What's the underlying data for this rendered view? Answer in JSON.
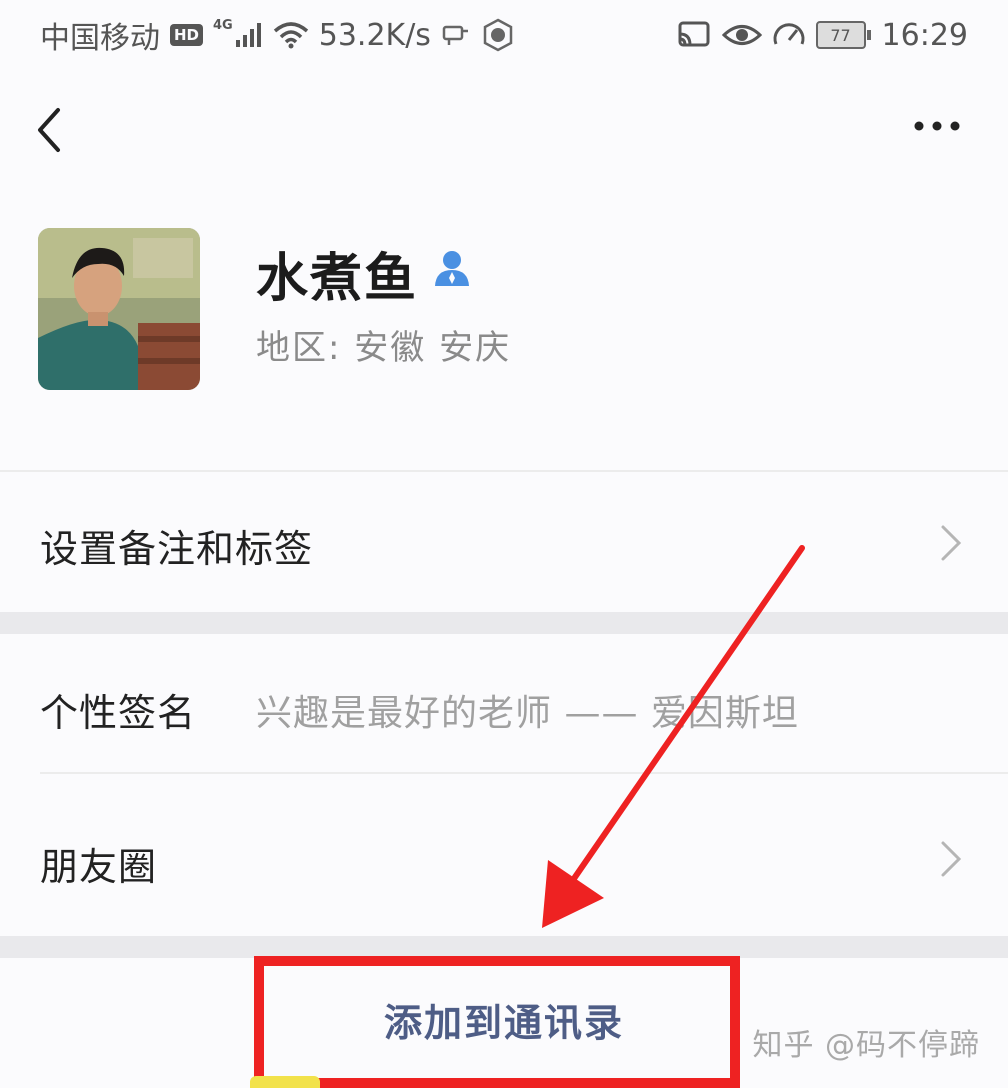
{
  "status_bar": {
    "carrier": "中国移动",
    "hd_badge": "HD",
    "network_type": "4G",
    "net_speed": "53.2K/s",
    "battery_level": "77",
    "time": "16:29"
  },
  "profile": {
    "name": "水煮鱼",
    "region": "地区: 安徽  安庆"
  },
  "rows": {
    "remark": {
      "label": "设置备注和标签"
    },
    "signature": {
      "label": "个性签名",
      "value": "兴趣是最好的老师 —— 爱因斯坦"
    },
    "moments": {
      "label": "朋友圈"
    }
  },
  "actions": {
    "add_contact_label": "添加到通讯录"
  },
  "watermark": "知乎 @码不停蹄",
  "colors": {
    "accent_link": "#4e5d86",
    "highlight": "#ee2222",
    "verified_icon": "#4a90e2"
  }
}
